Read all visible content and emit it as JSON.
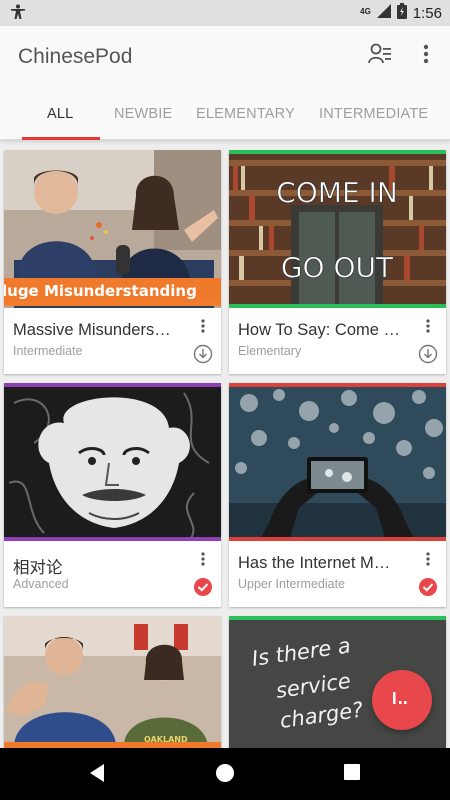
{
  "status_bar": {
    "time": "1:56",
    "network": "4G",
    "icons": [
      "accessibility-icon",
      "signal-icon",
      "battery-icon"
    ]
  },
  "app_bar": {
    "title": "ChinesePod",
    "icons": [
      "profile-list-icon",
      "overflow-menu-icon"
    ]
  },
  "tabs": [
    {
      "label": "ALL",
      "active": true
    },
    {
      "label": "NEWBIE",
      "active": false
    },
    {
      "label": "ELEMENTARY",
      "active": false
    },
    {
      "label": "INTERMEDIATE",
      "active": false
    }
  ],
  "lessons": [
    {
      "title": "Massive Misunders…",
      "level": "Intermediate",
      "level_color": "#f57c2a",
      "thumb_text": "luge Misunderstanding",
      "status": "download"
    },
    {
      "title": "How To Say: Come …",
      "level": "Elementary",
      "level_color": "#2bbf5a",
      "thumb_text": "COME IN",
      "thumb_text2": "GO OUT",
      "status": "download"
    },
    {
      "title": "相对论",
      "level": "Advanced",
      "level_color": "#8e3fb3",
      "status": "completed"
    },
    {
      "title": "Has the Internet M…",
      "level": "Upper Intermediate",
      "level_color": "#d9413a",
      "status": "completed"
    },
    {
      "title": "",
      "level": "",
      "level_color": "#f57c2a",
      "thumb_text": "OAKLAND",
      "status": ""
    },
    {
      "title": "",
      "level": "",
      "level_color": "#2bbf5a",
      "thumb_text": "Is there a",
      "thumb_text2": "service",
      "thumb_text3": "charge?",
      "status": ""
    }
  ],
  "colors": {
    "accent": "#e53935",
    "fab": "#e8474c"
  },
  "fab": {
    "icon": "chart-bars-icon"
  },
  "nav_bar": {
    "icons": [
      "back-icon",
      "home-icon",
      "recents-icon"
    ]
  }
}
